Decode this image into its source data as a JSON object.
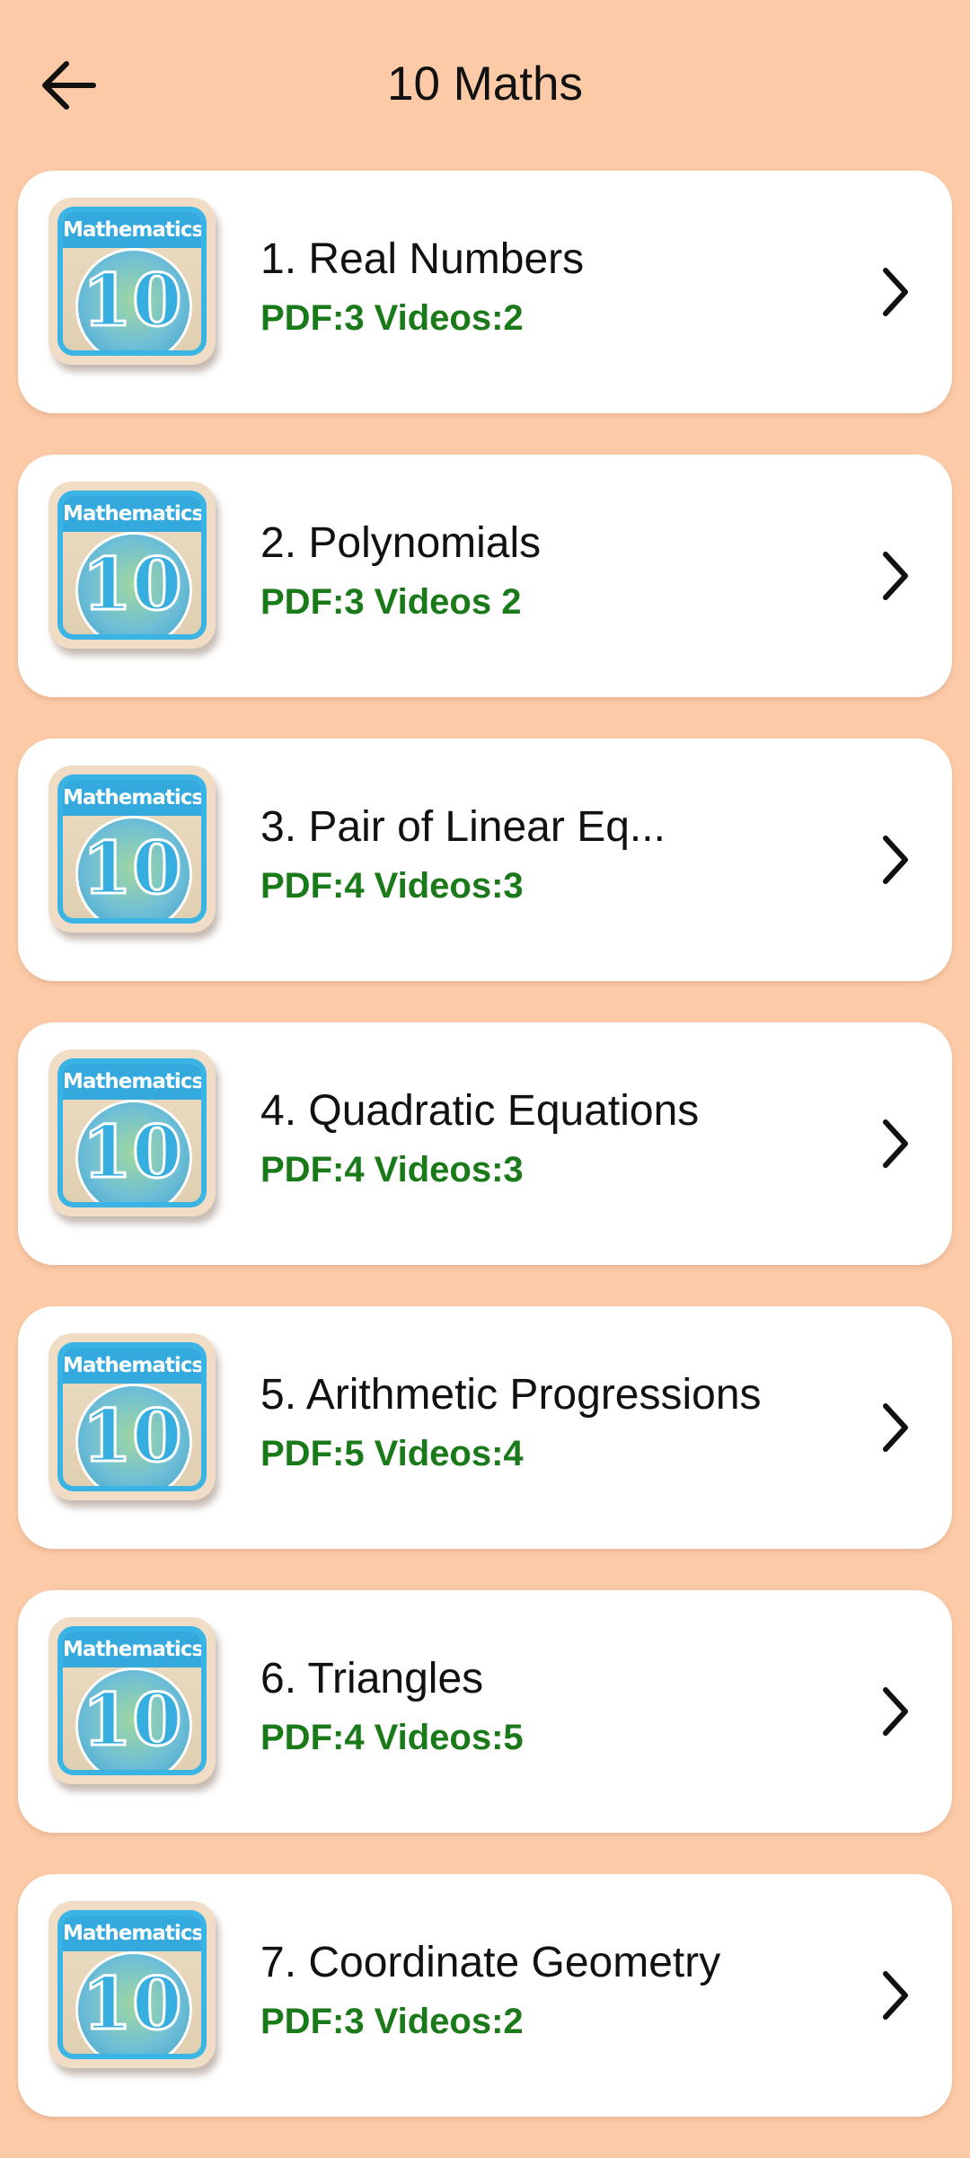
{
  "header": {
    "back_icon": "arrow-left-icon",
    "title": "10 Maths"
  },
  "thumbnail": {
    "label": "Mathematics",
    "number": "10"
  },
  "chapters": [
    {
      "title": "1. Real Numbers",
      "meta": "PDF:3 Videos:2"
    },
    {
      "title": "2. Polynomials",
      "meta": "PDF:3 Videos 2"
    },
    {
      "title": "3. Pair of Linear Eq...",
      "meta": "PDF:4 Videos:3"
    },
    {
      "title": "4. Quadratic Equations",
      "meta": "PDF:4 Videos:3"
    },
    {
      "title": "5. Arithmetic Progressions",
      "meta": "PDF:5 Videos:4"
    },
    {
      "title": "6. Triangles",
      "meta": "PDF:4 Videos:5"
    },
    {
      "title": "7. Coordinate Geometry",
      "meta": "PDF:3 Videos:2"
    }
  ],
  "colors": {
    "background": "#fccaa7",
    "card": "#ffffff",
    "meta_text": "#1a7a1a",
    "thumbnail_blue": "#39b4e4"
  }
}
